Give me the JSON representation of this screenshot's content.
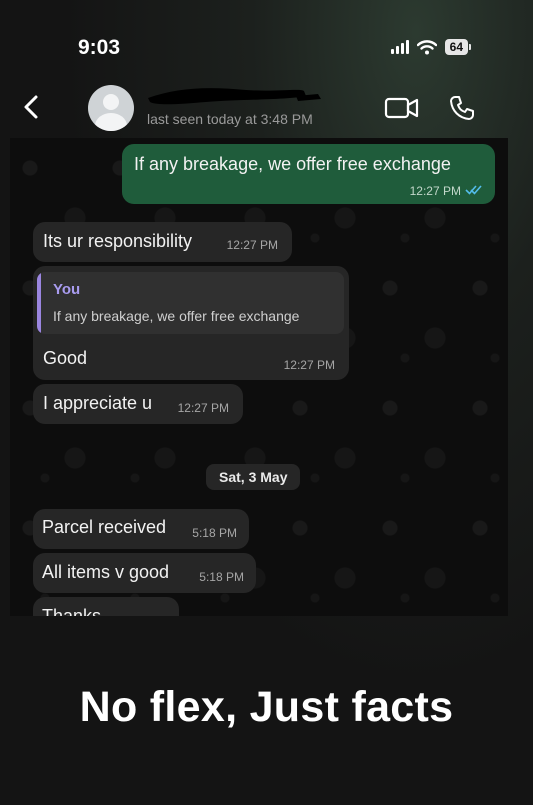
{
  "status_bar": {
    "time": "9:03",
    "battery": "64"
  },
  "header": {
    "contact_name": "",
    "last_seen": "last seen today at 3:48 PM"
  },
  "chat": {
    "messages": [
      {
        "direction": "out",
        "text": "If any breakage, we offer free exchange",
        "time": "12:27 PM",
        "read": true
      },
      {
        "direction": "in",
        "text": "Its ur responsibility",
        "time": "12:27 PM"
      },
      {
        "direction": "in",
        "reply_to": {
          "author": "You",
          "text": "If any breakage, we offer free exchange"
        },
        "text": "Good",
        "time": "12:27 PM"
      },
      {
        "direction": "in",
        "text": "I appreciate u",
        "time": "12:27 PM"
      },
      {
        "direction": "in",
        "text": "Parcel received",
        "time": "5:18 PM"
      },
      {
        "direction": "in",
        "text": "All items v good",
        "time": "5:18 PM"
      },
      {
        "direction": "in",
        "text": "Thanks",
        "time": ""
      }
    ],
    "date_separator": "Sat, 3 May"
  },
  "caption": "No flex, Just facts",
  "colors": {
    "outgoing_bubble": "#1f5c3b",
    "incoming_bubble": "#262626",
    "read_ticks": "#53bdeb",
    "quote_author": "#a99cf0"
  },
  "icons": [
    "back-arrow-icon",
    "avatar-placeholder-icon",
    "video-call-icon",
    "phone-call-icon",
    "signal-icon",
    "wifi-icon",
    "battery-icon",
    "double-check-icon"
  ]
}
